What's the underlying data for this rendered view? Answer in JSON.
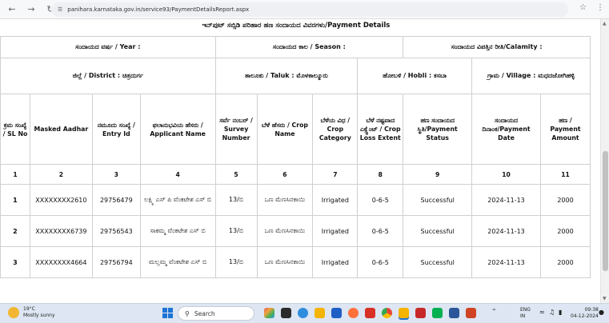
{
  "browser": {
    "url": "panihara.karnataka.gov.in/service93/PaymentDetailsReport.aspx"
  },
  "report": {
    "title": "ಇನ್‌ಪುಟ್ ಸಬ್ಸಿಡಿ ಪರಿಹಾರ ಹಣ ಸಂದಾಯದ ವಿವರಗಳು/Payment Details",
    "year_label": "ಸಂದಾಯದ ವರ್ಷ / Year :",
    "season_label": "ಸಂದಾಯದ ಕಾಲ / Season :",
    "calamity_label": "ಸಂದಾಯದ ವಿಪತ್ತಿನ ರೀತಿ/Calamity :",
    "district_label": "ಜಿಲ್ಲೆ / District : ಚಿತ್ರದುರ್ಗ",
    "taluk_label": "ತಾಲೂಕು / Taluk : ಮೊಳಕಾಲ್ಮೂರು",
    "hobli_label": "ಹೋಬಳಿ / Hobli : ಕಸಬಾ",
    "village_label": "ಗ್ರಾಮ / Village : ಮಧದಜೋಗಿಹಳ್ಳಿ",
    "columns": [
      "ಕ್ರಮ ಸಂಖ್ಯೆ / SL No",
      "Masked Aadhar",
      "ನಮೂದು ಸಂಖ್ಯೆ / Entry Id",
      "ಫಲಾನುಭವಿಯ ಹೆಸರು / Applicant Name",
      "ಸರ್ವೆ ನಂಬರ್ / Survey Number",
      "ಬೆಳೆ ಹೆಸರು / Crop Name",
      "ಬೆಳೆಯ ವಿಧ / Crop Category",
      "ಬೆಳೆ ನಷ್ಟವಾದ ಎಕ್ಸ್ಟೆಂಟ್ / Crop Loss Extent",
      "ಹಣ ಸಂದಾಯದ ಸ್ಥಿತಿ/Payment Status",
      "ಸಂದಾಯದ ದಿನಾಂಕ/Payment Date",
      "ಹಣ / Payment Amount"
    ],
    "column_numbers": [
      "1",
      "2",
      "3",
      "4",
      "5",
      "6",
      "7",
      "8",
      "9",
      "10",
      "11"
    ],
    "rows": [
      [
        "1",
        "XXXXXXXX2610",
        "29756479",
        "ಲಕ್ಷ್ಮಿ ಎಸ್ ಪಿ ವೆಂಕಟೇಶ ಎಸ್ ಬಿ",
        "13/ಬಿ",
        "ಒಣ ಮೆಣಸಿನಕಾಯಿ",
        "Irrigated",
        "0-6-5",
        "Successful",
        "2024-11-13",
        "2000"
      ],
      [
        "2",
        "XXXXXXXX6739",
        "29756543",
        "ಸಾಕಮ್ಮ ವೆಂಕಟೇಶ ಎಸ್ ಬಿ",
        "13/ಬಿ",
        "ಒಣ ಮೆಣಸಿನಕಾಯಿ",
        "Irrigated",
        "0-6-5",
        "Successful",
        "2024-11-13",
        "2000"
      ],
      [
        "3",
        "XXXXXXXX4664",
        "29756794",
        "ಮಲ್ಲಮ್ಮ ವೆಂಕಟೇಶ ಎಸ್ ಬಿ",
        "13/ಬಿ",
        "ಒಣ ಮೆಣಸಿನಕಾಯಿ",
        "Irrigated",
        "0-6-5",
        "Successful",
        "2024-11-13",
        "2000"
      ]
    ]
  },
  "taskbar": {
    "weather_temp": "19°C",
    "weather_desc": "Mostly sunny",
    "search_placeholder": "Search",
    "lang_line1": "ENG",
    "lang_line2": "IN",
    "time": "09:38",
    "date": "04-12-2024"
  }
}
